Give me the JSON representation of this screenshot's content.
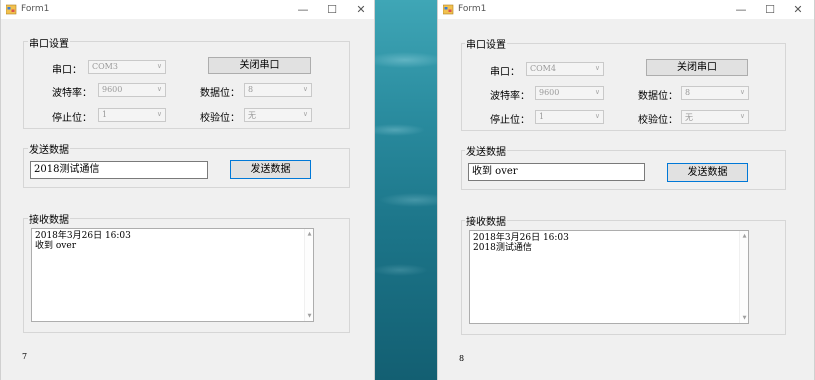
{
  "left_window": {
    "title": "Form1",
    "controls": {
      "minimize": "—",
      "maximize": "☐",
      "close": "✕"
    },
    "serial_group": {
      "title": "串口设置",
      "port_label": "串口：",
      "port_value": "COM3",
      "baud_label": "波特率：",
      "baud_value": "9600",
      "stop_label": "停止位：",
      "stop_value": "1",
      "data_bits_label": "数据位：",
      "data_bits_value": "8",
      "parity_label": "校验位：",
      "parity_value": "无",
      "toggle_button": "关闭串口"
    },
    "send_group": {
      "title": "发送数据",
      "input_value": "2018测试通信",
      "send_button": "发送数据"
    },
    "receive_group": {
      "title": "接收数据",
      "lines": [
        "2018年3月26日 16:03",
        "收到 over"
      ]
    },
    "counter": "7"
  },
  "right_window": {
    "title": "Form1",
    "controls": {
      "minimize": "—",
      "maximize": "☐",
      "close": "✕"
    },
    "serial_group": {
      "title": "串口设置",
      "port_label": "串口：",
      "port_value": "COM4",
      "baud_label": "波特率：",
      "baud_value": "9600",
      "stop_label": "停止位：",
      "stop_value": "1",
      "data_bits_label": "数据位：",
      "data_bits_value": "8",
      "parity_label": "校验位：",
      "parity_value": "无",
      "toggle_button": "关闭串口"
    },
    "send_group": {
      "title": "发送数据",
      "input_value": "收到 over",
      "send_button": "发送数据"
    },
    "receive_group": {
      "title": "接收数据",
      "lines": [
        "2018年3月26日 16:03",
        "2018测试通信"
      ]
    },
    "counter": "8"
  },
  "colors": {
    "window_bg": "#f0f0f0",
    "accent_focus": "#0078d7",
    "desktop": "#1f7c8f"
  },
  "icons": {
    "combo_arrow": "chevron-down-icon",
    "app": "form-app-icon"
  }
}
